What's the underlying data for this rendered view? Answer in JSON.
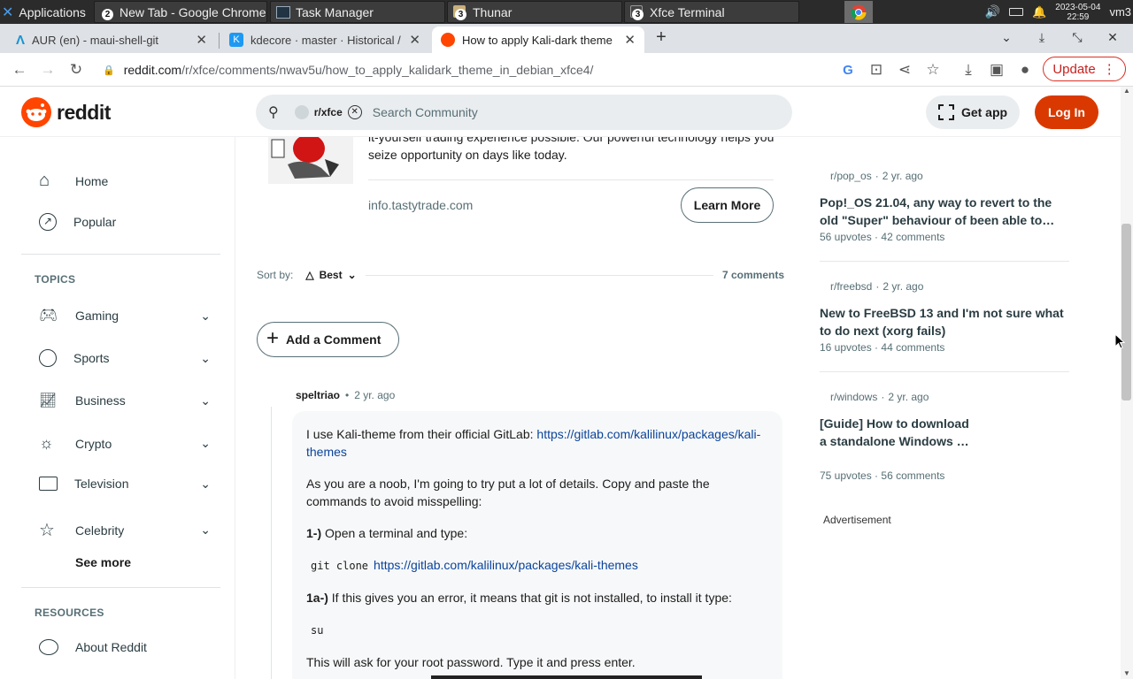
{
  "taskbar": {
    "apps_label": "Applications",
    "windows": [
      {
        "title": "New Tab - Google Chrome",
        "count": "2"
      },
      {
        "title": "Task Manager",
        "count": ""
      },
      {
        "title": "Thunar",
        "count": "3"
      },
      {
        "title": "Xfce Terminal",
        "count": "3"
      }
    ],
    "date": "2023-05-04",
    "time": "22:59",
    "user": "vm3"
  },
  "browser": {
    "tabs": [
      {
        "title": "AUR (en) - maui-shell-git",
        "icon": "aur-icon"
      },
      {
        "title": "kdecore · master · Historical / KDE",
        "icon": "kde-icon"
      },
      {
        "title": "How to apply Kali-dark theme",
        "icon": "reddit-icon"
      }
    ],
    "url_host": "reddit.com",
    "url_path": "/r/xfce/comments/nwav5u/how_to_apply_kalidark_theme_in_debian_xfce4/",
    "update_label": "Update"
  },
  "reddit_header": {
    "logo_text": "reddit",
    "community_chip": "r/xfce",
    "search_placeholder": "Search Community",
    "get_app": "Get app",
    "login": "Log In"
  },
  "left_nav": {
    "home": "Home",
    "popular": "Popular",
    "topics_heading": "TOPICS",
    "topics": [
      {
        "label": "Gaming",
        "icon": "gamepad-icon"
      },
      {
        "label": "Sports",
        "icon": "ball-icon"
      },
      {
        "label": "Business",
        "icon": "chart-icon"
      },
      {
        "label": "Crypto",
        "icon": "sun-icon"
      },
      {
        "label": "Television",
        "icon": "tv-icon"
      },
      {
        "label": "Celebrity",
        "icon": "star-icon"
      }
    ],
    "see_more": "See more",
    "resources_heading": "RESOURCES",
    "about": "About Reddit"
  },
  "ad": {
    "text": "it-yourself trading experience possible. Our powerful technology helps you seize opportunity on days like today.",
    "domain": "info.tastytrade.com",
    "cta": "Learn More"
  },
  "comments": {
    "sort_label": "Sort by:",
    "sort_value": "Best",
    "count": "7 comments",
    "add_comment": "Add a Comment",
    "first": {
      "author": "speltriao",
      "time": "2 yr. ago",
      "p1_text": "I use Kali-theme from their official GitLab:",
      "p1_link": "https://gitlab.com/kalilinux/packages/kali-themes",
      "p2": "As you are a noob, I'm going to try put a lot of details. Copy and paste the commands to avoid misspelling:",
      "step1_label": "1-)",
      "step1_text": "Open a terminal and type:",
      "code1": "git clone",
      "code1_link": "https://gitlab.com/kalilinux/packages/kali-themes",
      "step1a_label": "1a-)",
      "step1a_text": "If this gives you an error, it means that git is not installed, to install it type:",
      "code2": "su",
      "p_last": "This will ask for your root password. Type it and press enter."
    }
  },
  "related": [
    {
      "community": "r/pop_os",
      "time": "2 yr. ago",
      "title": "Pop!_OS 21.04, any way to revert to the old \"Super\" behaviour of been able to…",
      "upvotes": "56 upvotes",
      "comments": "42 comments"
    },
    {
      "community": "r/freebsd",
      "time": "2 yr. ago",
      "title": "New to FreeBSD 13 and I'm not sure what to do next (xorg fails)",
      "upvotes": "16 upvotes",
      "comments": "44 comments"
    },
    {
      "community": "r/windows",
      "time": "2 yr. ago",
      "title": "[Guide] How to download a standalone Windows …",
      "upvotes": "75 upvotes",
      "comments": "56 comments"
    }
  ],
  "advertisement_label": "Advertisement",
  "colors": {
    "reddit_orange": "#ff4500",
    "login_bg": "#d93900",
    "link": "#0a449b"
  }
}
